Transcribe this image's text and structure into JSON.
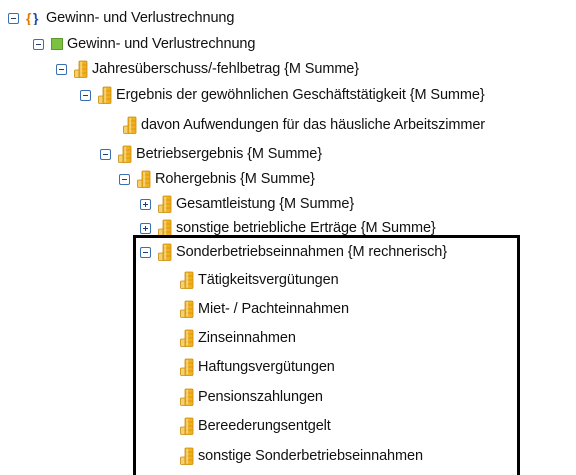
{
  "tree": {
    "root": "Gewinn- und Verlustrechnung",
    "statement": "Gewinn- und Verlustrechnung",
    "jahresueberschuss": "Jahresüberschuss/-fehlbetrag {M Summe}",
    "ergebnis": "Ergebnis der gewöhnlichen Geschäftstätigkeit {M Summe}",
    "arbeitszimmer": "davon Aufwendungen für das häusliche Arbeitszimmer",
    "betriebsergebnis": "Betriebsergebnis {M Summe}",
    "rohergebnis": "Rohergebnis {M Summe}",
    "gesamtleistung": "Gesamtleistung {M Summe}",
    "sonstige_ertraege": "sonstige betriebliche Erträge {M Summe}",
    "sonderbetriebseinnahmen": "Sonderbetriebseinnahmen {M rechnerisch}",
    "children": [
      "Tätigkeitsvergütungen",
      "Miet- / Pachteinnahmen",
      "Zinseinnahmen",
      "Haftungsvergütungen",
      "Pensionszahlungen",
      "Bereederungsentgelt",
      "sonstige Sonderbetriebseinnahmen"
    ]
  },
  "icons": {
    "root": "braces-icon",
    "statement": "green-square-icon",
    "concept": "coins-icon"
  },
  "colors": {
    "root_brace_left": "#e07a00",
    "root_brace_right": "#1f4fa8",
    "statement_square": "#7cc242",
    "coin_gold": "#f2b01e",
    "highlight_border": "#000000"
  }
}
